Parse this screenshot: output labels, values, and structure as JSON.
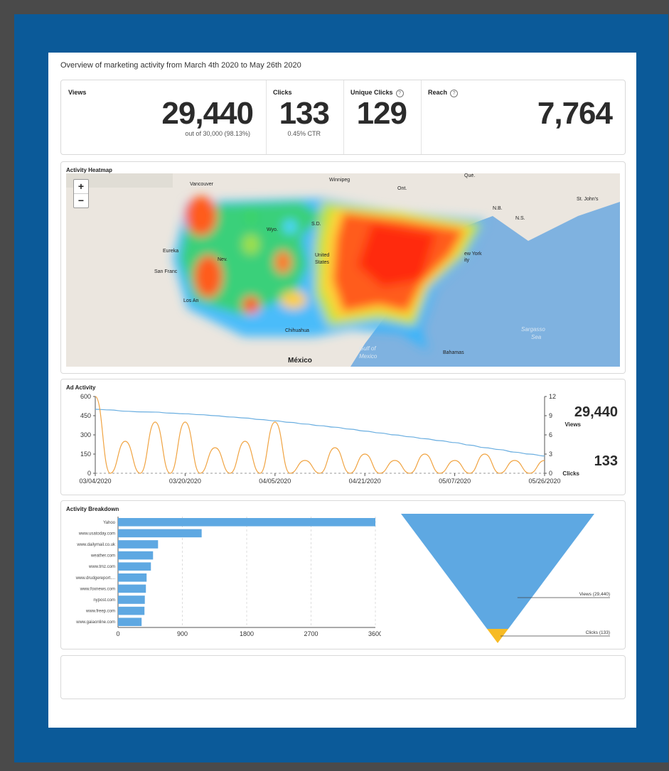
{
  "overview_title": "Overview of marketing activity from March 4th 2020 to May 26th 2020",
  "stats": {
    "views": {
      "label": "Views",
      "value": "29,440",
      "sub": "out of 30,000 (98.13%)"
    },
    "clicks": {
      "label": "Clicks",
      "value": "133",
      "sub": "0.45% CTR"
    },
    "unique_clicks": {
      "label": "Unique Clicks",
      "value": "129"
    },
    "reach": {
      "label": "Reach",
      "value": "7,764"
    }
  },
  "heatmap": {
    "title": "Activity Heatmap",
    "zoom_in": "+",
    "zoom_out": "−",
    "labels": {
      "vancouver": "Vancouver",
      "winnipeg": "Winnipeg",
      "que": "Qué.",
      "stjohns": "St. John's",
      "ont": "Ont.",
      "eureka": "Eureka",
      "sanfrancisco": "San Franc",
      "losangeles": "Los An",
      "united": "United",
      "states": "States",
      "newyork": "ew York",
      "city": "ity",
      "chihuahua": "Chihuahua",
      "mexico": "México",
      "gulf1": "Gulf of",
      "gulf2": "Mexico",
      "bahamas": "Bahamas",
      "sargasso1": "Sargasso",
      "sargasso2": "Sea",
      "nev": "Nev.",
      "wyo": "Wyo.",
      "sd": "S.D.",
      "nb": "N.B.",
      "ns": "N.S."
    }
  },
  "ad_activity": {
    "title": "Ad Activity",
    "views_total": "29,440",
    "views_label": "Views",
    "clicks_total": "133",
    "clicks_label": "Clicks"
  },
  "chart_data": [
    {
      "type": "line",
      "title": "Ad Activity",
      "x_ticks": [
        "03/04/2020",
        "03/20/2020",
        "04/05/2020",
        "04/21/2020",
        "05/07/2020",
        "05/26/2020"
      ],
      "y_left_ticks": [
        "600",
        "450",
        "300",
        "150",
        "0"
      ],
      "y_right_ticks": [
        "12",
        "9",
        "6",
        "3",
        "0"
      ],
      "y_left_range": [
        0,
        600
      ],
      "y_right_range": [
        0,
        12
      ],
      "series": [
        {
          "name": "Views",
          "axis": "left",
          "color": "#6aaee0",
          "values": [
            500,
            495,
            485,
            480,
            478,
            470,
            465,
            458,
            450,
            440,
            432,
            420,
            410,
            398,
            385,
            372,
            360,
            345,
            330,
            315,
            300,
            285,
            270,
            255,
            240,
            220,
            200,
            185,
            165,
            150,
            135
          ]
        },
        {
          "name": "Clicks",
          "axis": "right",
          "color": "#f0a341",
          "values": [
            12,
            0,
            5,
            0,
            8,
            0,
            8,
            0,
            4,
            0,
            5,
            0,
            8,
            0,
            2,
            0,
            4,
            0,
            3,
            0,
            2,
            0,
            3,
            0,
            2,
            0,
            3,
            0,
            2,
            0,
            2
          ]
        }
      ]
    },
    {
      "type": "bar",
      "title": "Activity Breakdown",
      "orientation": "horizontal",
      "categories": [
        "Yahoo",
        "www.usatoday.com",
        "www.dailymail.co.uk",
        "weather.com",
        "www.tmz.com",
        "www.drudgereport....",
        "www.foxnews.com",
        "nypost.com",
        "www.freep.com",
        "www.gaiaonline.com"
      ],
      "values": [
        3600,
        1170,
        560,
        490,
        460,
        400,
        390,
        375,
        370,
        330
      ],
      "x_ticks": [
        "0",
        "900",
        "1800",
        "2700",
        "3600"
      ],
      "xlim": [
        0,
        3600
      ],
      "color": "#5ea8e2"
    },
    {
      "type": "funnel",
      "stages": [
        {
          "label": "Views (29,440)",
          "value": 29440,
          "color": "#5ea8e2"
        },
        {
          "label": "Clicks (133)",
          "value": 133,
          "color": "#f7bb24"
        }
      ]
    }
  ]
}
